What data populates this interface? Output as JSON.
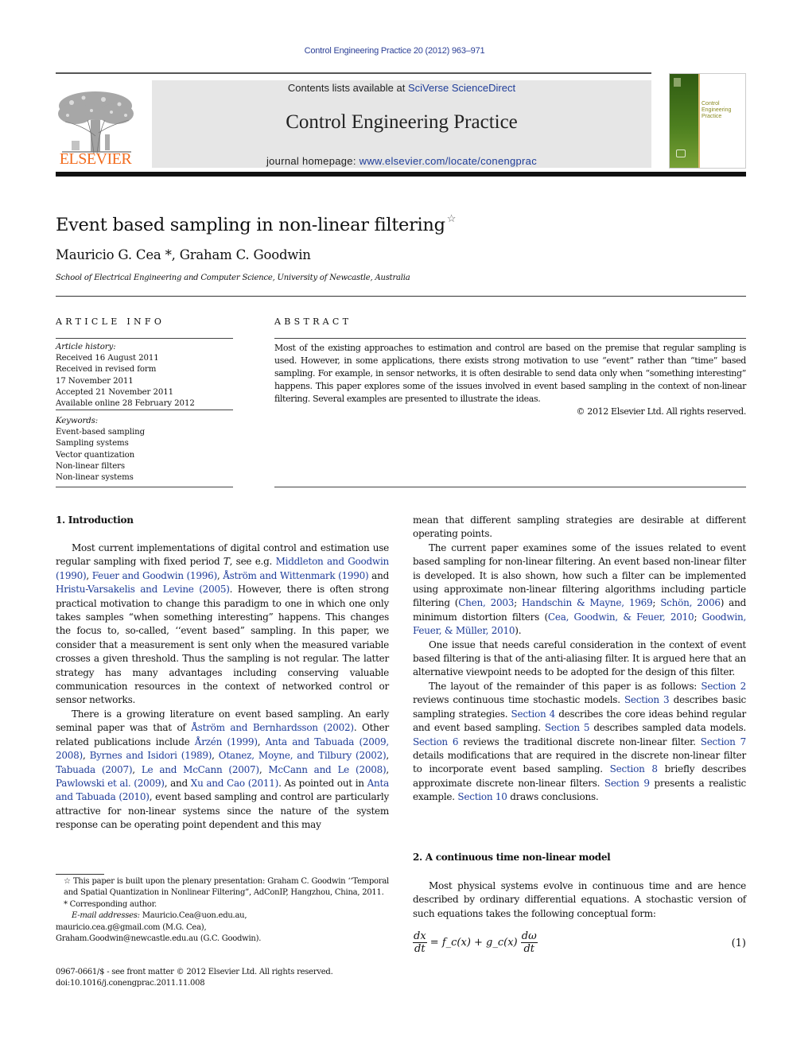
{
  "header": {
    "citation": "Control Engineering Practice 20 (2012) 963–971",
    "contents_prefix": "Contents lists available at ",
    "contents_link": "SciVerse ScienceDirect",
    "journal_name": "Control Engineering Practice",
    "homepage_prefix": "journal homepage: ",
    "homepage_link": "www.elsevier.com/locate/conengprac",
    "publisher_logo": "ELSEVIER",
    "cover_title_lines": [
      "Control",
      "Engineering",
      "Practice"
    ],
    "colors": {
      "citation": "#2b3f96",
      "link": "#1f3d99",
      "publisher": "#f26b1d",
      "cover_green": "#4d7f1f"
    }
  },
  "article": {
    "title": "Event based sampling in non-linear filtering",
    "title_mark": "☆",
    "authors": "Mauricio G. Cea *, Graham C. Goodwin",
    "affiliation": "School of Electrical Engineering and Computer Science, University of Newcastle, Australia"
  },
  "article_info": {
    "heading": "ARTICLE INFO",
    "history_label": "Article history:",
    "history": [
      "Received 16 August 2011",
      "Received in revised form",
      "17 November 2011",
      "Accepted 21 November 2011",
      "Available online 28 February 2012"
    ],
    "keywords_label": "Keywords:",
    "keywords": [
      "Event-based sampling",
      "Sampling systems",
      "Vector quantization",
      "Non-linear filters",
      "Non-linear systems"
    ]
  },
  "abstract": {
    "heading": "ABSTRACT",
    "text": "Most of the existing approaches to estimation and control are based on the premise that regular sampling is used. However, in some applications, there exists strong motivation to use “event” rather than “time” based sampling. For example, in sensor networks, it is often desirable to send data only when “something interesting” happens. This paper explores some of the issues involved in event based sampling in the context of non-linear filtering. Several examples are presented to illustrate the ideas.",
    "copyright": "© 2012 Elsevier Ltd. All rights reserved."
  },
  "section1": {
    "heading": "1.   Introduction",
    "p1": [
      {
        "t": "Most current implementations of digital control and estimation use regular sampling with fixed period "
      },
      {
        "t": "T",
        "i": true
      },
      {
        "t": ", see e.g. "
      },
      {
        "t": "Middleton and Goodwin (1990)",
        "link": true
      },
      {
        "t": ", "
      },
      {
        "t": "Feuer and Goodwin (1996)",
        "link": true
      },
      {
        "t": ", "
      },
      {
        "t": "Åström and Wittenmark (1990)",
        "link": true
      },
      {
        "t": " and "
      },
      {
        "t": "Hristu-Varsakelis and Levine (2005)",
        "link": true
      },
      {
        "t": ". However, there is often strong practical motivation to change this paradigm to one in which one only takes samples “when something interesting” happens. This changes the focus to, so-called, ‘‘event based” sampling. In this paper, we consider that a measurement is sent only when the measured variable crosses a given threshold. Thus the sampling is not regular. The latter strategy has many advantages including conserving valuable communication resources in the context of networked control or sensor networks."
      }
    ],
    "p2": [
      {
        "t": "There is a growing literature on event based sampling. An early seminal paper was that of "
      },
      {
        "t": "Åström and Bernhardsson (2002)",
        "link": true
      },
      {
        "t": ". Other related publications include "
      },
      {
        "t": "Årzén (1999)",
        "link": true
      },
      {
        "t": ", "
      },
      {
        "t": "Anta and Tabuada (2009, 2008)",
        "link": true
      },
      {
        "t": ", "
      },
      {
        "t": "Byrnes and Isidori (1989)",
        "link": true
      },
      {
        "t": ", "
      },
      {
        "t": "Otanez, Moyne, and Tilbury (2002)",
        "link": true
      },
      {
        "t": ", "
      },
      {
        "t": "Tabuada (2007)",
        "link": true
      },
      {
        "t": ", "
      },
      {
        "t": "Le and McCann (2007)",
        "link": true
      },
      {
        "t": ", "
      },
      {
        "t": "McCann and Le (2008)",
        "link": true
      },
      {
        "t": ", "
      },
      {
        "t": "Pawlowski et al. (2009)",
        "link": true
      },
      {
        "t": ", and "
      },
      {
        "t": "Xu and Cao (2011)",
        "link": true
      },
      {
        "t": ". As pointed out in "
      },
      {
        "t": "Anta and Tabuada (2010)",
        "link": true
      },
      {
        "t": ", event based sampling and control are particularly attractive for non-linear systems since the nature of the system response can be operating point dependent and this may"
      }
    ],
    "p3_cont": [
      {
        "t": "mean that different sampling strategies are desirable at different operating points."
      }
    ],
    "p4": [
      {
        "t": "The current paper examines some of the issues related to event based sampling for non-linear filtering. An event based non-linear filter is developed. It is also shown, how such a filter can be implemented using approximate non-linear filtering algorithms including particle filtering ("
      },
      {
        "t": "Chen, 2003",
        "link": true
      },
      {
        "t": "; "
      },
      {
        "t": "Handschin & Mayne, 1969",
        "link": true
      },
      {
        "t": "; "
      },
      {
        "t": "Schön, 2006",
        "link": true
      },
      {
        "t": ") and minimum distortion filters ("
      },
      {
        "t": "Cea, Goodwin, & Feuer, 2010",
        "link": true
      },
      {
        "t": "; "
      },
      {
        "t": "Goodwin, Feuer, & Müller, 2010",
        "link": true
      },
      {
        "t": ")."
      }
    ],
    "p5": [
      {
        "t": "One issue that needs careful consideration in the context of event based filtering is that of the anti-aliasing filter. It is argued here that an alternative viewpoint needs to be adopted for the design of this filter."
      }
    ],
    "p6": [
      {
        "t": "The layout of the remainder of this paper is as follows: "
      },
      {
        "t": "Section 2",
        "link": true
      },
      {
        "t": " reviews continuous time stochastic models. "
      },
      {
        "t": "Section 3",
        "link": true
      },
      {
        "t": " describes basic sampling strategies. "
      },
      {
        "t": "Section 4",
        "link": true
      },
      {
        "t": " describes the core ideas behind regular and event based sampling. "
      },
      {
        "t": "Section 5",
        "link": true
      },
      {
        "t": " describes sampled data models. "
      },
      {
        "t": "Section 6",
        "link": true
      },
      {
        "t": " reviews the traditional discrete non-linear filter. "
      },
      {
        "t": "Section 7",
        "link": true
      },
      {
        "t": " details modifications that are required in the discrete non-linear filter to incorporate event based sampling. "
      },
      {
        "t": "Section 8",
        "link": true
      },
      {
        "t": " briefly describes approximate discrete non-linear filters. "
      },
      {
        "t": "Section 9",
        "link": true
      },
      {
        "t": " presents a realistic example. "
      },
      {
        "t": "Section 10",
        "link": true
      },
      {
        "t": " draws conclusions."
      }
    ]
  },
  "section2": {
    "heading": "2.   A continuous time non-linear model",
    "p1": "Most physical systems evolve in continuous time and are hence described by ordinary differential equations. A stochastic version of such equations takes the following conceptual form:",
    "equation": {
      "lhs_num": "dx",
      "lhs_den": "dt",
      "middle": "= f_c(x) + g_c(x)",
      "rhs_num": "dω",
      "rhs_den": "dt",
      "number": "(1)"
    }
  },
  "footnotes": {
    "star_note": "☆ This paper is built upon the plenary presentation: Graham C. Goodwin ‘‘Temporal and Spatial Quantization in Nonlinear Filtering”, AdConIP, Hangzhou, China, 2011.",
    "corresponding": "* Corresponding author.",
    "email_label": "E-mail addresses:",
    "email_1": "Mauricio.Cea@uon.edu.au,",
    "email_2": "mauricio.cea.g@gmail.com (M.G. Cea),",
    "email_3": "Graham.Goodwin@newcastle.edu.au (G.C. Goodwin).",
    "front_matter": "0967-0661/$ - see front matter © 2012 Elsevier Ltd. All rights reserved.",
    "doi": "doi:10.1016/j.conengprac.2011.11.008"
  }
}
